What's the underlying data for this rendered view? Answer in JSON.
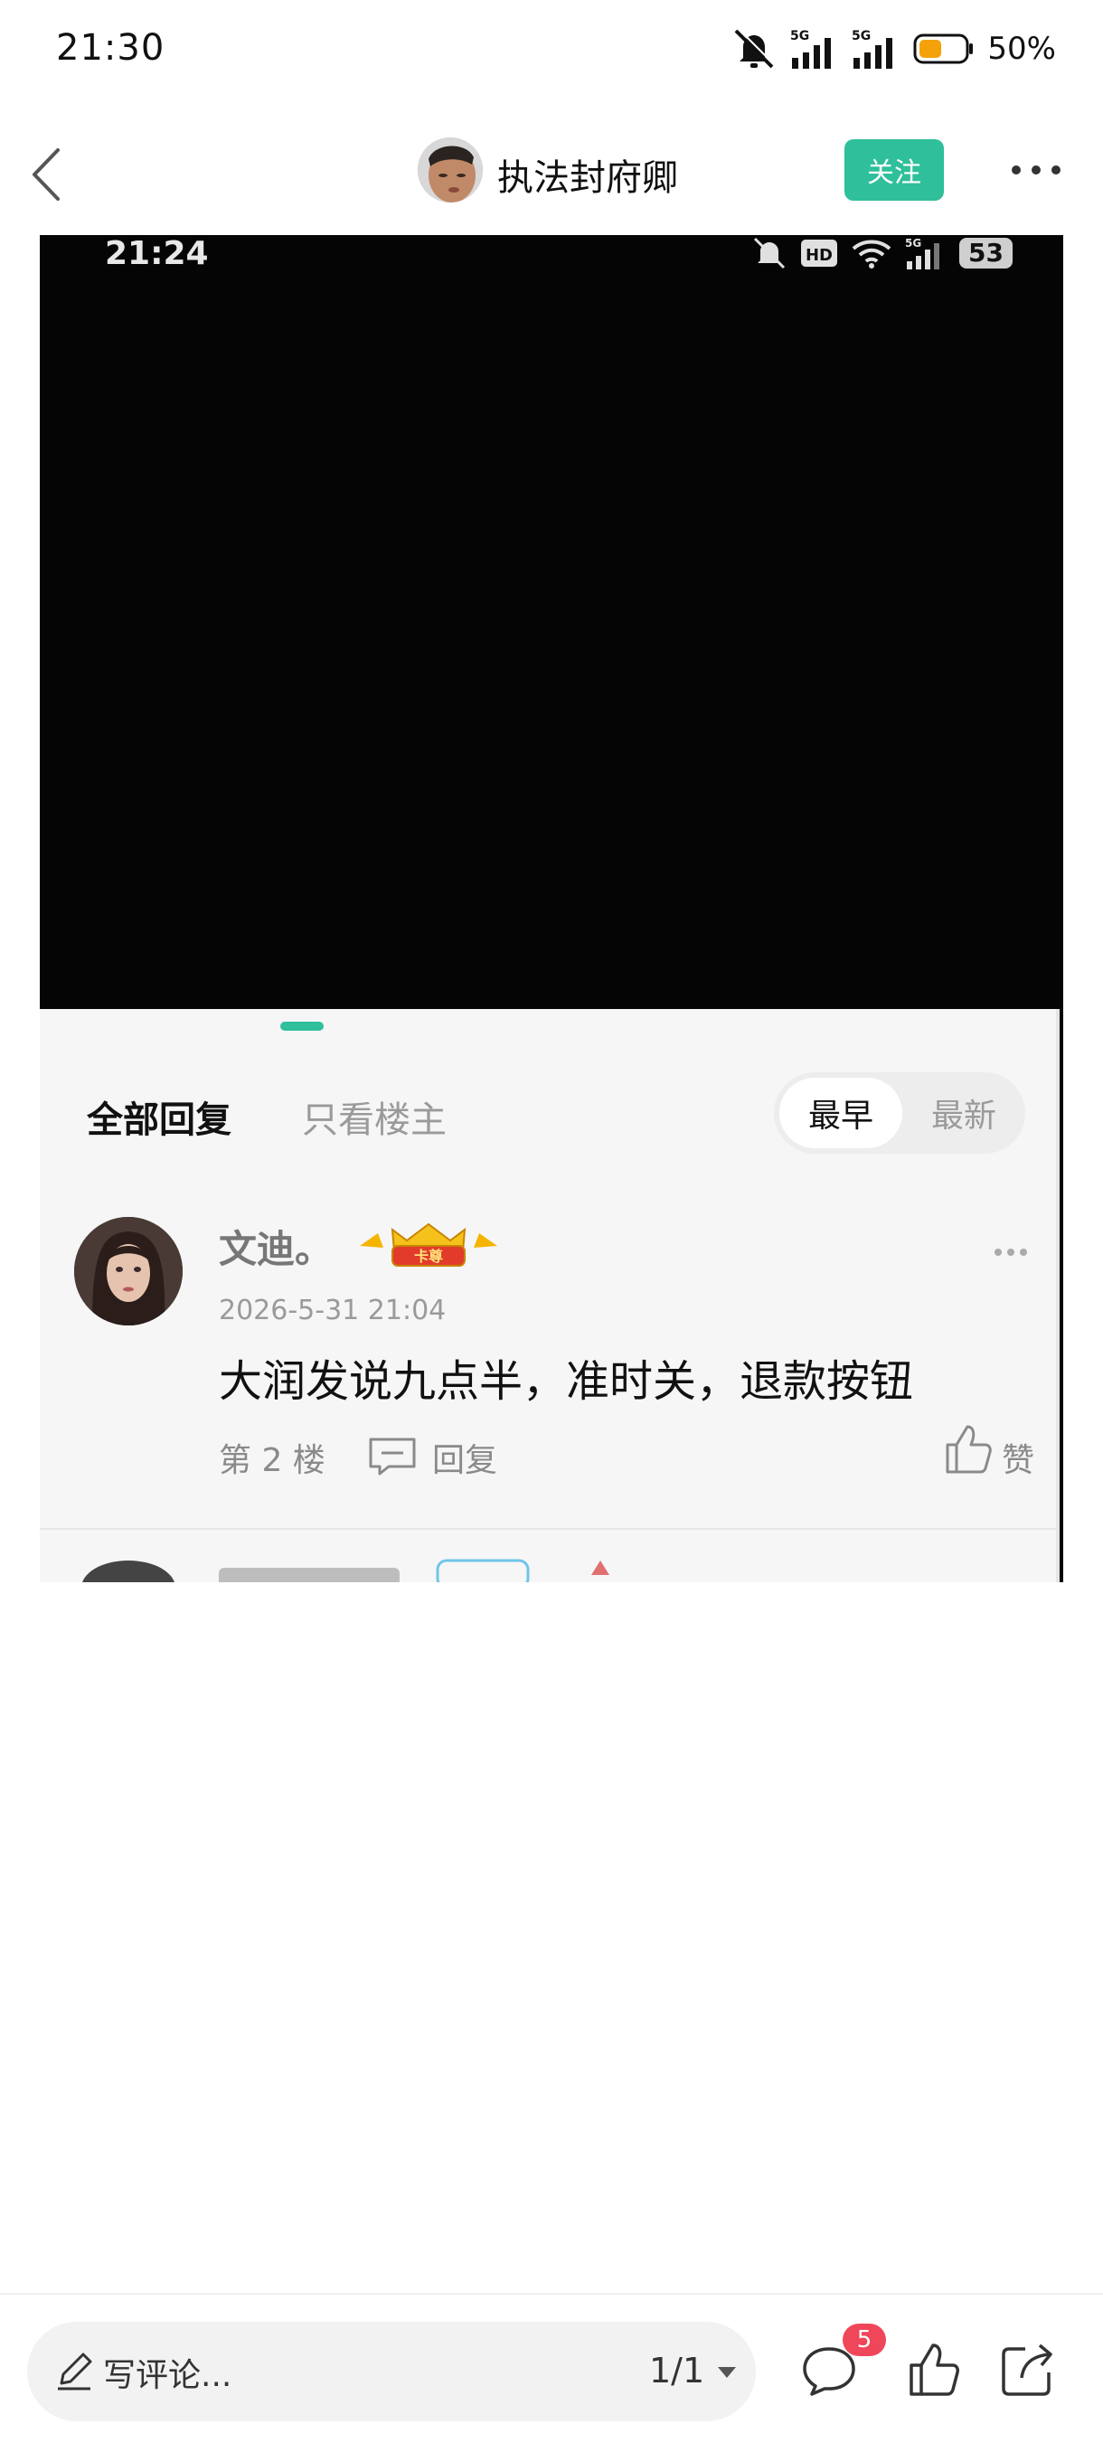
{
  "status_bar": {
    "time": "21:30",
    "network_1": "5G",
    "network_2": "5G",
    "battery": "50%"
  },
  "top_nav": {
    "author": "执法封府卿",
    "follow_label": "关注"
  },
  "screenshot": {
    "inner_time": "21:24",
    "inner_badge": "HD",
    "inner_network": "5G",
    "inner_battery": "53",
    "tabs": {
      "all_replies": "全部回复",
      "op_only": "只看楼主"
    },
    "sort": {
      "earliest": "最早",
      "latest": "最新"
    },
    "comment": {
      "user": "文迪。",
      "badge_text": "卡尊",
      "date": "2026-5-31 21:04",
      "text": "大润发说九点半，准时关，退款按钮",
      "floor": "第 2 楼",
      "reply_label": "回复",
      "like_label": "赞"
    }
  },
  "bottom_bar": {
    "comment_placeholder": "写评论...",
    "page_indicator": "1/1",
    "comment_count": "5"
  },
  "colors": {
    "accent": "#2fbf9b",
    "badge_red": "#f0465a"
  }
}
